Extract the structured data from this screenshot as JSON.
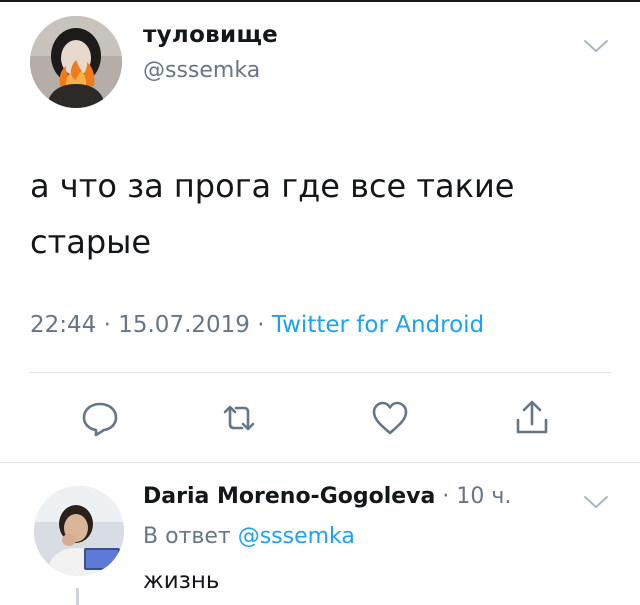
{
  "main_tweet": {
    "display_name": "туловище",
    "handle": "@sssemka",
    "text": "а что за прога где все такие старые",
    "time": "22:44",
    "date": "15.07.2019",
    "separator": "·",
    "source": "Twitter for Android"
  },
  "actions": {
    "reply_icon": "reply-icon",
    "retweet_icon": "retweet-icon",
    "like_icon": "heart-icon",
    "share_icon": "share-icon"
  },
  "reply_tweet": {
    "display_name": "Daria Moreno-Gogoleva",
    "time": "10 ч.",
    "separator": "·",
    "reply_prefix": "В ответ",
    "reply_mention": "@sssemka",
    "text": "жизнь"
  },
  "colors": {
    "text_primary": "#14171a",
    "text_secondary": "#657786",
    "accent_blue": "#1da1f2",
    "divider": "#e1e8ed",
    "icon_gray": "#657786"
  }
}
